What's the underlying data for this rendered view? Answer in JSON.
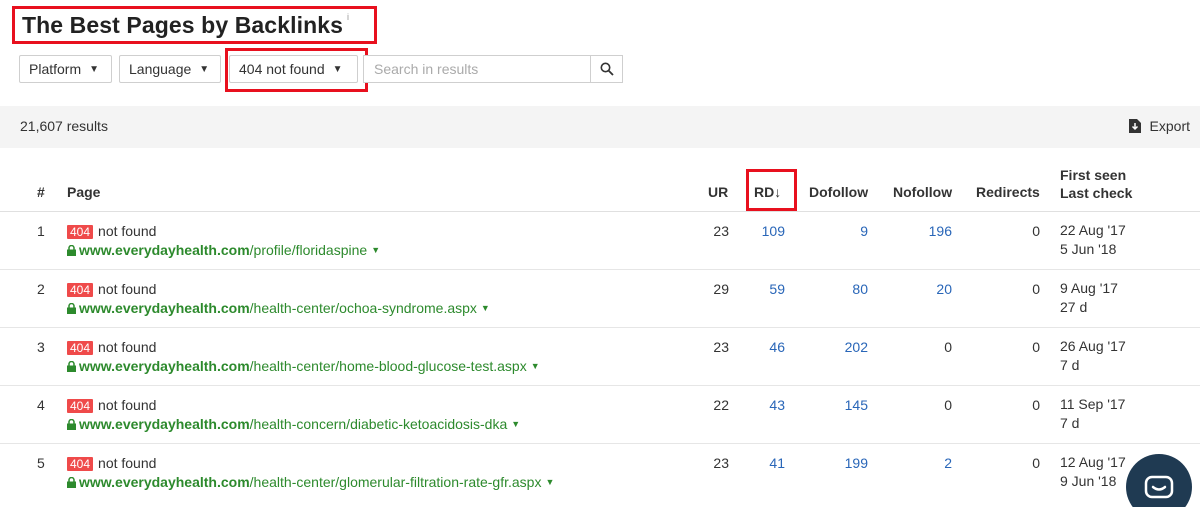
{
  "page": {
    "title": "The Best Pages by Backlinks",
    "title_info": "i"
  },
  "filters": {
    "platform": "Platform",
    "language": "Language",
    "status": "404 not found",
    "search_placeholder": "Search in results"
  },
  "results": {
    "count": "21,607 results",
    "export_label": "Export"
  },
  "table": {
    "headers": {
      "index": "#",
      "page": "Page",
      "ur": "UR",
      "rd": "RD",
      "rd_sort": "↓",
      "dofollow": "Dofollow",
      "nofollow": "Nofollow",
      "redirects": "Redirects",
      "first_seen": "First seen",
      "last_check": "Last check"
    },
    "rows": [
      {
        "index": "1",
        "badge": "404",
        "status": "not found",
        "domain": "www.everydayhealth.com",
        "path": "/profile/floridaspine",
        "ur": "23",
        "rd": "109",
        "dofollow": "9",
        "nofollow": "196",
        "redirects": "0",
        "first_seen": "22 Aug '17",
        "last_check": "5 Jun '18"
      },
      {
        "index": "2",
        "badge": "404",
        "status": "not found",
        "domain": "www.everydayhealth.com",
        "path": "/health-center/ochoa-syndrome.aspx",
        "ur": "29",
        "rd": "59",
        "dofollow": "80",
        "nofollow": "20",
        "redirects": "0",
        "first_seen": "9 Aug '17",
        "last_check": "27 d"
      },
      {
        "index": "3",
        "badge": "404",
        "status": "not found",
        "domain": "www.everydayhealth.com",
        "path": "/health-center/home-blood-glucose-test.aspx",
        "ur": "23",
        "rd": "46",
        "dofollow": "202",
        "nofollow": "0",
        "redirects": "0",
        "first_seen": "26 Aug '17",
        "last_check": "7 d"
      },
      {
        "index": "4",
        "badge": "404",
        "status": "not found",
        "domain": "www.everydayhealth.com",
        "path": "/health-concern/diabetic-ketoacidosis-dka",
        "ur": "22",
        "rd": "43",
        "dofollow": "145",
        "nofollow": "0",
        "redirects": "0",
        "first_seen": "11 Sep '17",
        "last_check": "7 d"
      },
      {
        "index": "5",
        "badge": "404",
        "status": "not found",
        "domain": "www.everydayhealth.com",
        "path": "/health-center/glomerular-filtration-rate-gfr.aspx",
        "ur": "23",
        "rd": "41",
        "dofollow": "199",
        "nofollow": "2",
        "redirects": "0",
        "first_seen": "12 Aug '17",
        "last_check": "9 Jun '18"
      }
    ]
  },
  "colors": {
    "highlight": "#e8101e",
    "link_blue": "#2966b8",
    "url_green": "#2d8a2d",
    "badge_red": "#ef4a4a"
  }
}
